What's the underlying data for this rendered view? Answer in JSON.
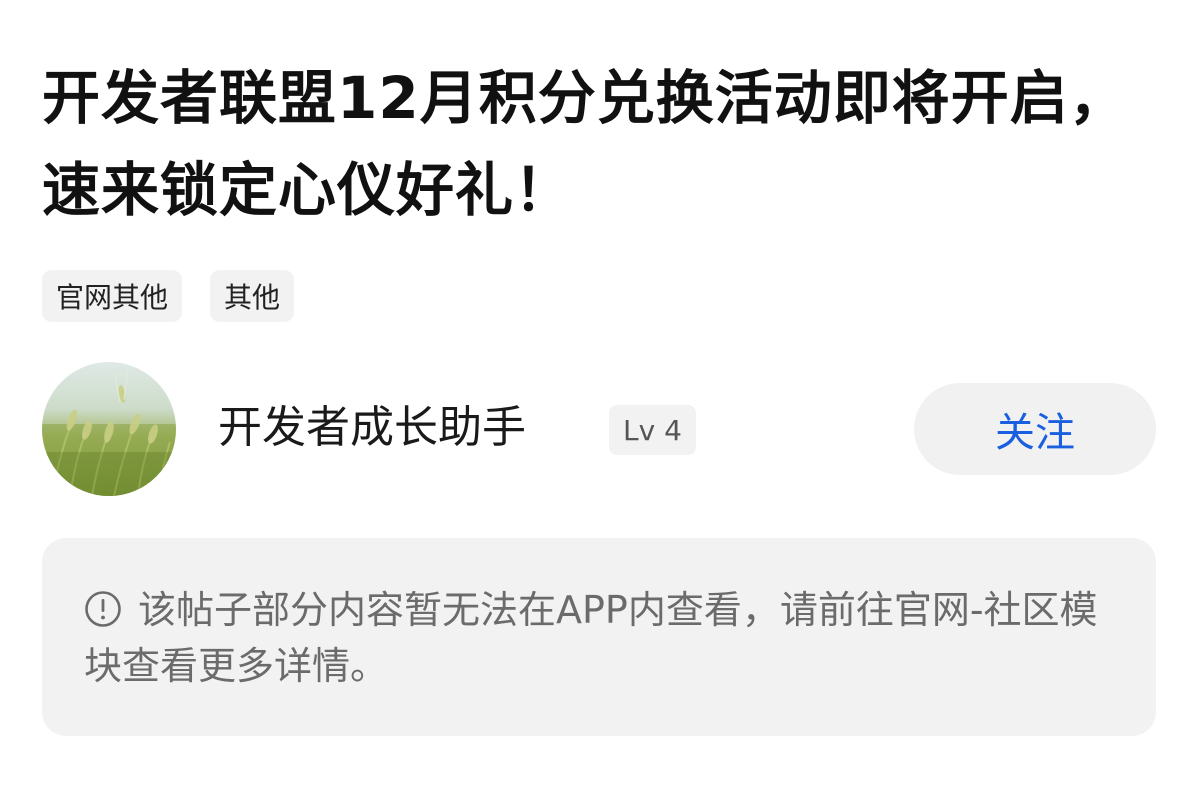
{
  "post": {
    "title": "开发者联盟12月积分兑换活动即将开启，速来锁定心仪好礼！",
    "tags": [
      "官网其他",
      "其他"
    ]
  },
  "author": {
    "name": "开发者成长助手",
    "level": "Lv 4",
    "avatar_icon": "wheat-field-avatar"
  },
  "follow": {
    "label": "关注",
    "color": "#1a5fe0"
  },
  "notice": {
    "icon": "info-circle-icon",
    "text": "该帖子部分内容暂无法在APP内查看，请前往官网-社区模块查看更多详情。"
  }
}
